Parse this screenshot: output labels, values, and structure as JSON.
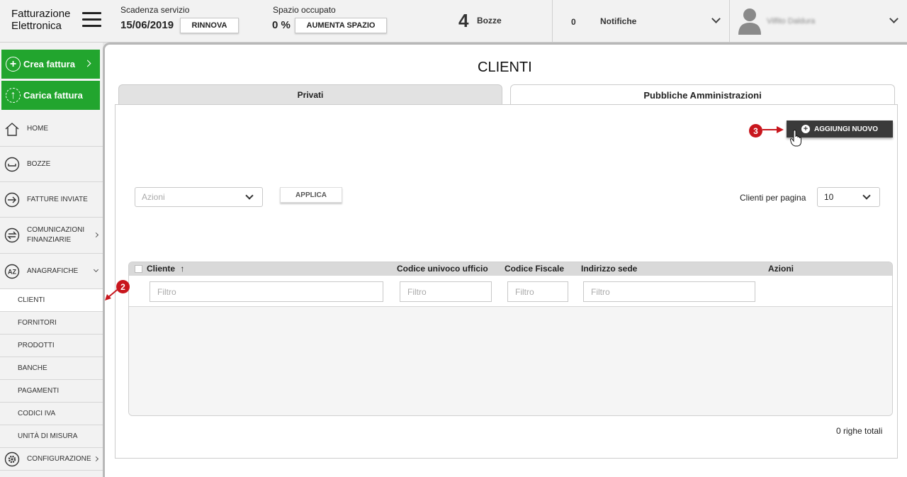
{
  "header": {
    "logo_line1": "Fatturazione",
    "logo_line2": "Elettronica",
    "service_label": "Scadenza servizio",
    "service_date": "15/06/2019",
    "renew_label": "RINNOVA",
    "space_label": "Spazio occupato",
    "space_value": "0 %",
    "increase_space_label": "AUMENTA SPAZIO",
    "drafts_count": "4",
    "drafts_label": "Bozze",
    "notifications_count": "0",
    "notifications_label": "Notifiche",
    "user_name": "Vilfito Daldura"
  },
  "sidebar": {
    "create_invoice": "Crea fattura",
    "upload_invoice": "Carica fattura",
    "items": [
      {
        "label": "HOME",
        "icon": "home-icon"
      },
      {
        "label": "BOZZE",
        "icon": "drafts-icon"
      },
      {
        "label": "FATTURE INVIATE",
        "icon": "sent-icon"
      },
      {
        "label": "COMUNICAZIONI FINANZIARIE",
        "line1": "COMUNICAZIONI",
        "line2": "FINANZIARIE",
        "icon": "exchange-icon"
      },
      {
        "label": "ANAGRAFICHE",
        "icon": "az-icon"
      }
    ],
    "subitems": [
      "CLIENTI",
      "FORNITORI",
      "PRODOTTI",
      "BANCHE",
      "PAGAMENTI",
      "CODICI IVA",
      "UNITÀ DI MISURA"
    ],
    "config_label": "CONFIGURAZIONE"
  },
  "main": {
    "title": "CLIENTI",
    "tabs": [
      {
        "label": "Privati",
        "active": false
      },
      {
        "label": "Pubbliche Amministrazioni",
        "active": true
      }
    ],
    "add_new_label": "AGGIUNGI NUOVO",
    "actions_placeholder": "Azioni",
    "apply_label": "APPLICA",
    "per_page_label": "Clienti per pagina",
    "per_page_value": "10",
    "columns": [
      "Cliente",
      "Codice univoco ufficio",
      "Codice Fiscale",
      "Indirizzo sede",
      "Azioni"
    ],
    "sort_indicator": "↑",
    "filter_placeholder": "Filtro",
    "totals": "0 righe totali"
  },
  "annotations": {
    "badge_sidebar": "2",
    "badge_add": "3",
    "badge_color": "#c8161d"
  },
  "colors": {
    "green": "#22a52e",
    "dark_button": "#3a3a3a"
  }
}
